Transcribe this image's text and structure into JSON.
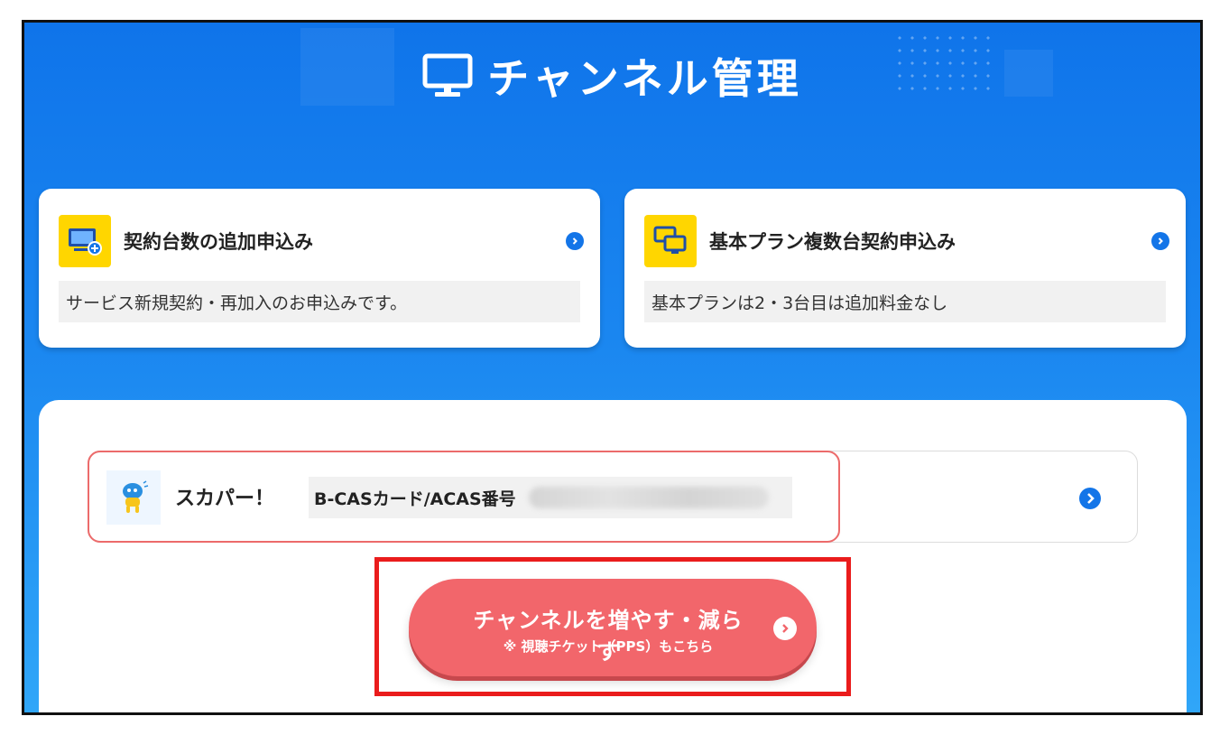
{
  "header": {
    "title": "チャンネル管理",
    "icon": "monitor-icon"
  },
  "cards": [
    {
      "title": "契約台数の追加申込み",
      "desc": "サービス新規契約・再加入のお申込みです。",
      "icon": "monitor-plus-icon"
    },
    {
      "title": "基本プラン複数台契約申込み",
      "desc": "基本プランは2・3台目は追加料金なし",
      "icon": "multi-monitor-icon"
    }
  ],
  "subscriber": {
    "provider": "スカパー！",
    "card_label": "B-CASカード/ACAS番号",
    "icon": "skyperfect-mascot-icon"
  },
  "cta": {
    "main": "チャンネルを増やす・減らす",
    "sub": "※ 視聴チケット（PPS）もこちら"
  },
  "colors": {
    "header_blue": "#0f74ea",
    "card_icon_yellow": "#ffd600",
    "cta_red": "#f2666b",
    "highlight_red": "#ea1c1c",
    "arrow_blue": "#1375e8"
  }
}
